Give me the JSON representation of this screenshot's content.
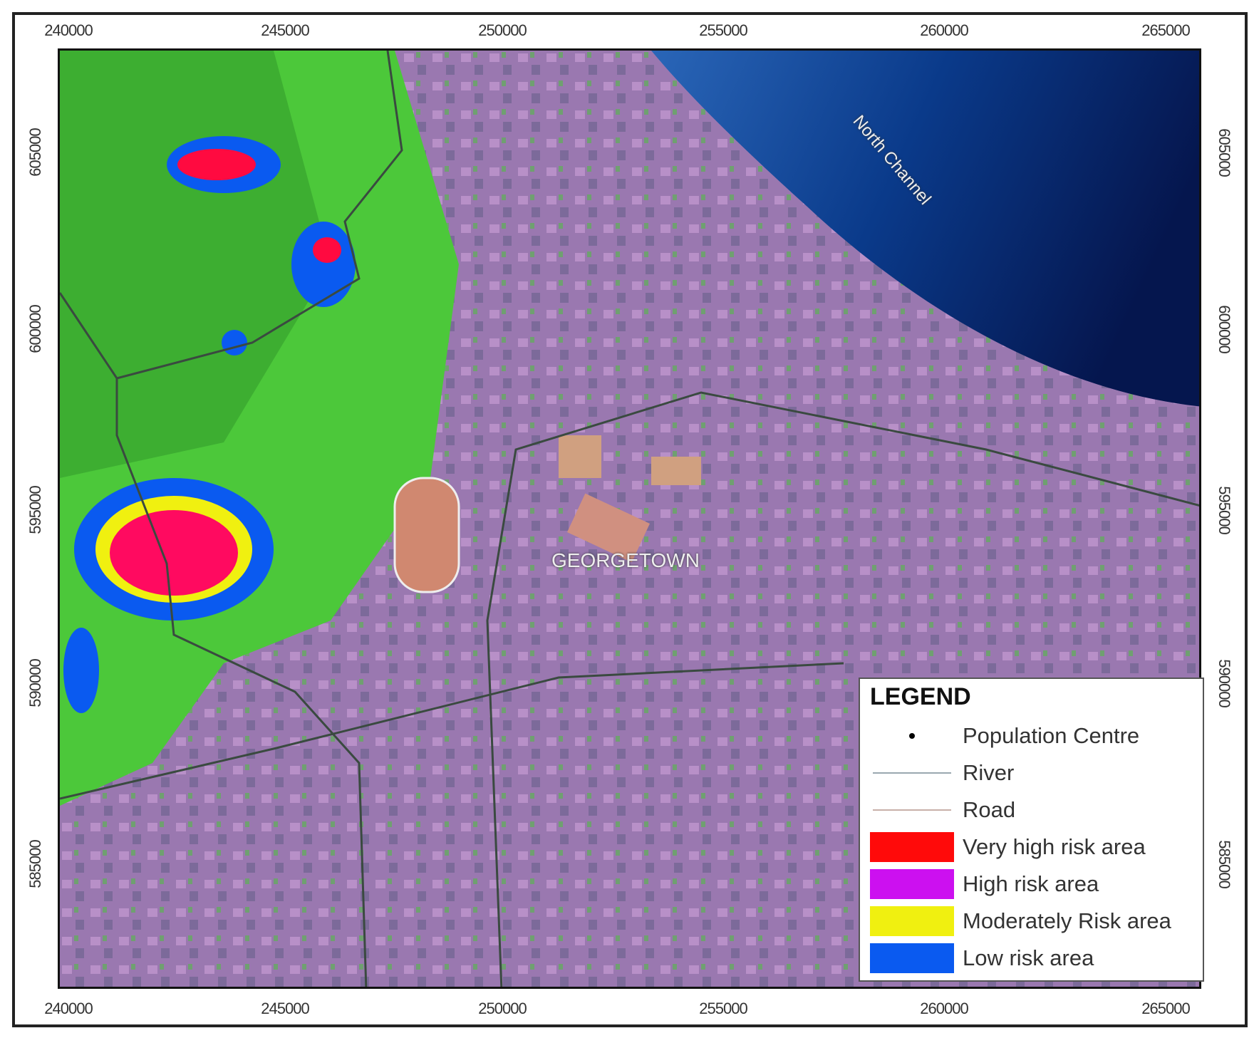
{
  "axes": {
    "top": [
      "240000",
      "245000",
      "250000",
      "255000",
      "260000",
      "265000"
    ],
    "bottom": [
      "240000",
      "245000",
      "250000",
      "255000",
      "260000",
      "265000"
    ],
    "left": [
      "605000",
      "600000",
      "595000",
      "590000",
      "585000"
    ],
    "right": [
      "605000",
      "600000",
      "595000",
      "590000",
      "585000"
    ]
  },
  "map_labels": {
    "town": "GEORGETOWN",
    "sea": "North Channel"
  },
  "legend": {
    "title": "LEGEND",
    "items": [
      {
        "label": "Population Centre",
        "symbol": "dot",
        "color": "#000000"
      },
      {
        "label": "River",
        "symbol": "line",
        "color": "#9aa8b0"
      },
      {
        "label": "Road",
        "symbol": "line",
        "color": "#c8b0a8"
      },
      {
        "label": "Very high risk area",
        "symbol": "box",
        "color": "#ff0a0a"
      },
      {
        "label": "High risk area",
        "symbol": "box",
        "color": "#cc10f0"
      },
      {
        "label": "Moderately Risk area",
        "symbol": "box",
        "color": "#f0f010"
      },
      {
        "label": "Low risk area",
        "symbol": "box",
        "color": "#0a5af0"
      }
    ]
  }
}
